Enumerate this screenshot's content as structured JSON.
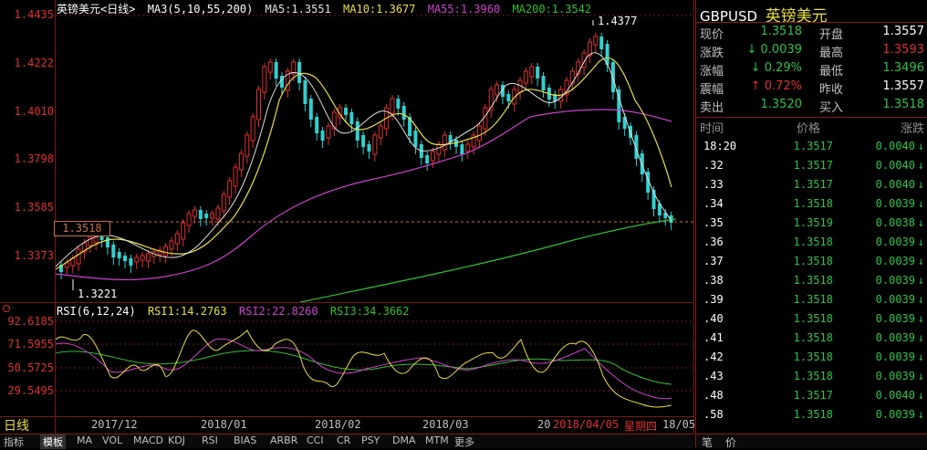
{
  "header": {
    "symbol": "英镑美元",
    "period": "<日线>",
    "ma_def": "MA3(5,10,55,200)",
    "ma5": "MA5:1.3551",
    "ma10": "MA10:1.3677",
    "ma55": "MA55:1.3960",
    "ma200": "MA200:1.3542"
  },
  "colors": {
    "ma5": "#e0e0e0",
    "ma10": "#e8e040",
    "ma55": "#d040d0",
    "ma200": "#30c030",
    "up": "#e03030",
    "down": "#30d0d0",
    "axis": "#e03030",
    "green": "#2fc24a",
    "red": "#e03030"
  },
  "price_axis": [
    "1.4435",
    "1.4222",
    "1.4010",
    "1.3798",
    "1.3585",
    "1.3373"
  ],
  "annotations": {
    "high": "1.4377",
    "low": "1.3221",
    "current_tag": "1.3518"
  },
  "rsi": {
    "title": "RSI(6,12,24)",
    "rsi1": "RSI1:14.2763",
    "rsi2": "RSI2:22.8260",
    "rsi3": "RSI3:34.3662",
    "axis": [
      "92.6185",
      "71.5955",
      "50.5725",
      "29.5495"
    ]
  },
  "date_axis": [
    "2017/12",
    "2018/01",
    "2018/02",
    "2018/03",
    "20",
    "2018/04/05",
    "星期四",
    "18/05"
  ],
  "period_label": "日线",
  "bottom_tabs": [
    "指标",
    "模板",
    "MA",
    "VOL",
    "MACD",
    "KDJ",
    "RSI",
    "BIAS",
    "ARBR",
    "CCI",
    "CR",
    "PSY",
    "DMA",
    "MTM",
    "更多"
  ],
  "panel": {
    "code": "GBPUSD",
    "name": "英镑美元",
    "quotes": [
      {
        "l1": "现价",
        "v1": "1.3518",
        "c1": "#2fc24a",
        "l2": "开盘",
        "v2": "1.3557",
        "c2": "#ffffff"
      },
      {
        "l1": "涨跌",
        "v1": "0.0039",
        "arrow1": "down",
        "c1": "#2fc24a",
        "l2": "最高",
        "v2": "1.3593",
        "c2": "#e03030"
      },
      {
        "l1": "涨幅",
        "v1": "0.29%",
        "arrow1": "down",
        "c1": "#2fc24a",
        "l2": "最低",
        "v2": "1.3496",
        "c2": "#2fc24a"
      },
      {
        "l1": "震幅",
        "v1": "0.72%",
        "arrow1": "up",
        "c1": "#e03030",
        "l2": "昨收",
        "v2": "1.3557",
        "c2": "#ffffff"
      },
      {
        "l1": "卖出",
        "v1": "1.3520",
        "c1": "#2fc24a",
        "l2": "买入",
        "v2": "1.3518",
        "c2": "#2fc24a"
      }
    ],
    "table_headers": [
      "时间",
      "价格",
      "涨跌"
    ],
    "ticks": [
      {
        "t": "18:20",
        "p": "1.3517",
        "c": "0.0040"
      },
      {
        "t": ".32",
        "p": "1.3517",
        "c": "0.0040"
      },
      {
        "t": ".33",
        "p": "1.3517",
        "c": "0.0040"
      },
      {
        "t": ".34",
        "p": "1.3518",
        "c": "0.0039"
      },
      {
        "t": ".35",
        "p": "1.3519",
        "c": "0.0038"
      },
      {
        "t": ".36",
        "p": "1.3518",
        "c": "0.0039"
      },
      {
        "t": ".37",
        "p": "1.3518",
        "c": "0.0039"
      },
      {
        "t": ".38",
        "p": "1.3518",
        "c": "0.0039"
      },
      {
        "t": ".39",
        "p": "1.3518",
        "c": "0.0039"
      },
      {
        "t": ".40",
        "p": "1.3518",
        "c": "0.0039"
      },
      {
        "t": ".41",
        "p": "1.3518",
        "c": "0.0039"
      },
      {
        "t": ".42",
        "p": "1.3518",
        "c": "0.0039"
      },
      {
        "t": ".43",
        "p": "1.3518",
        "c": "0.0039"
      },
      {
        "t": ".48",
        "p": "1.3517",
        "c": "0.0040"
      },
      {
        "t": ".58",
        "p": "1.3518",
        "c": "0.0039"
      }
    ],
    "bottom_tabs": [
      "笔",
      "价"
    ]
  }
}
